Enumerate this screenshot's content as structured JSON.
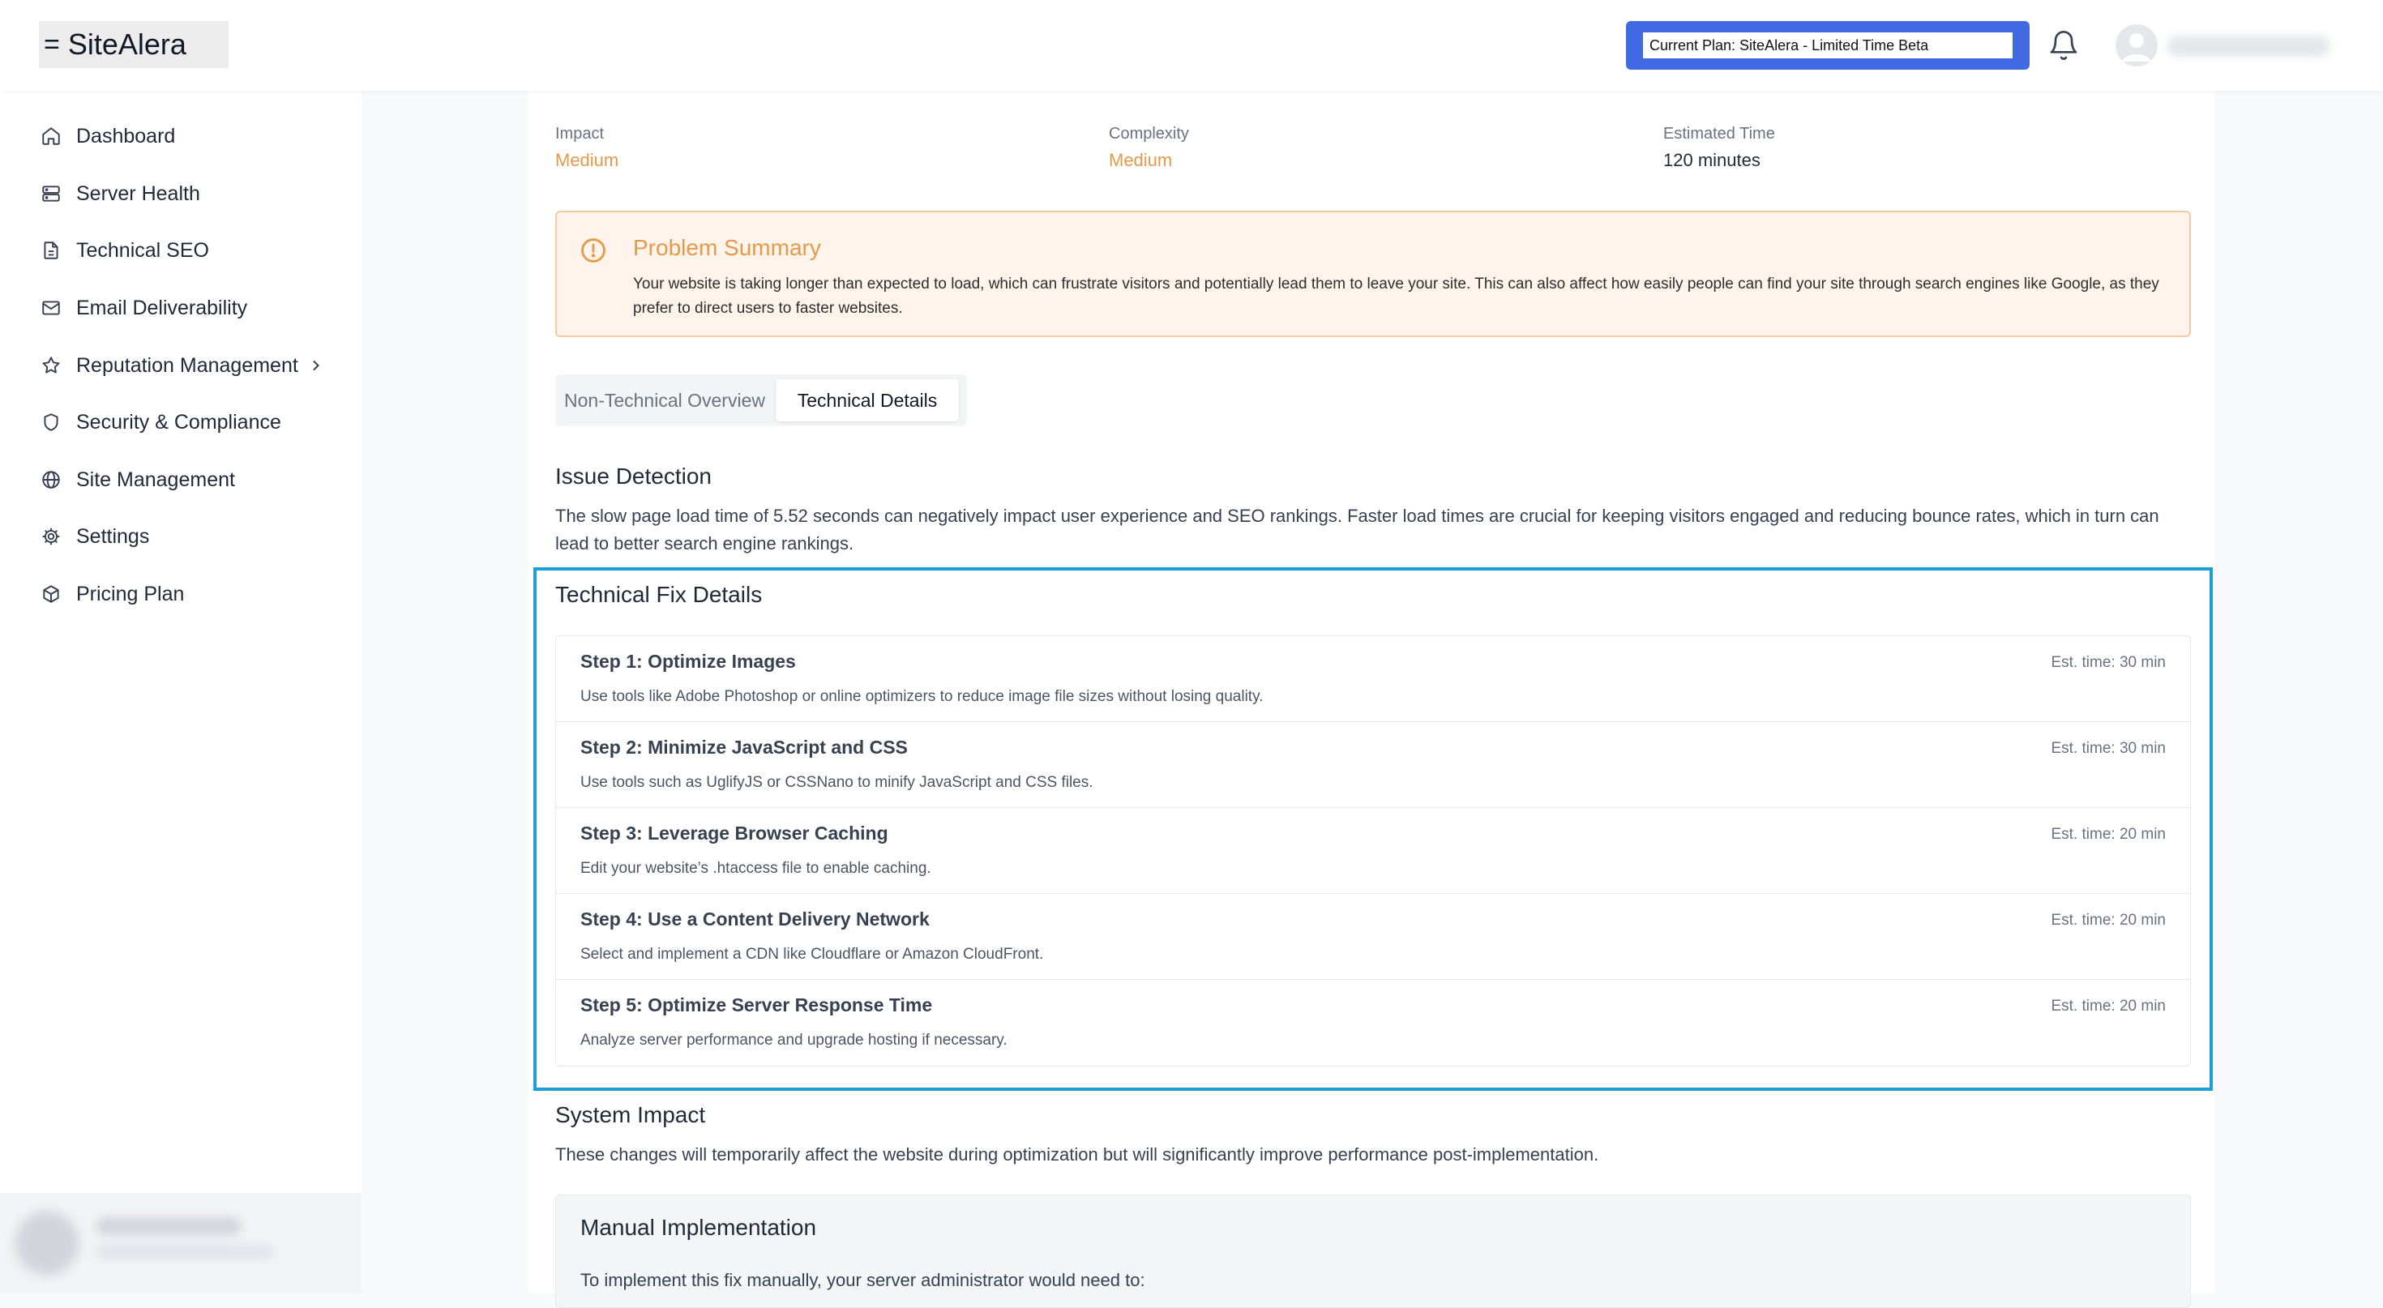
{
  "header": {
    "logo_text": "SiteAlera",
    "logo_icon": "menu-icon",
    "plan_label": "Current Plan: SiteAlera - Limited Time Beta",
    "plan_color": "#4169e1"
  },
  "sidebar": {
    "items": [
      {
        "label": "Dashboard",
        "icon": "home-icon"
      },
      {
        "label": "Server Health",
        "icon": "server-icon"
      },
      {
        "label": "Technical SEO",
        "icon": "document-icon"
      },
      {
        "label": "Email Deliverability",
        "icon": "mail-icon"
      },
      {
        "label": "Reputation Management",
        "icon": "star-icon"
      },
      {
        "label": "Security & Compliance",
        "icon": "shield-icon"
      },
      {
        "label": "Site Management",
        "icon": "globe-icon"
      },
      {
        "label": "Settings",
        "icon": "gear-icon"
      },
      {
        "label": "Pricing Plan",
        "icon": "package-icon"
      }
    ]
  },
  "meta": {
    "impact_label": "Impact",
    "impact_value": "Medium",
    "complexity_label": "Complexity",
    "complexity_value": "Medium",
    "time_label": "Estimated Time",
    "time_value": "120 minutes",
    "accent_color": "#e59a4a"
  },
  "problem": {
    "title": "Problem Summary",
    "text": "Your website is taking longer than expected to load, which can frustrate visitors and potentially lead them to leave your site. This can also affect how easily people can find your site through search engines like Google, as they prefer to direct users to faster websites."
  },
  "tabs": {
    "non_technical": "Non-Technical Overview",
    "technical": "Technical Details",
    "active": "Technical Details"
  },
  "issue": {
    "title": "Issue Detection",
    "text": "The slow page load time of 5.52 seconds can negatively impact user experience and SEO rankings. Faster load times are crucial for keeping visitors engaged and reducing bounce rates, which in turn can lead to better search engine rankings."
  },
  "fix": {
    "title": "Technical Fix Details",
    "steps": [
      {
        "title": "Step 1: Optimize Images",
        "desc": "Use tools like Adobe Photoshop or online optimizers to reduce image file sizes without losing quality.",
        "time": "Est. time: 30 min"
      },
      {
        "title": "Step 2: Minimize JavaScript and CSS",
        "desc": "Use tools such as UglifyJS or CSSNano to minify JavaScript and CSS files.",
        "time": "Est. time: 30 min"
      },
      {
        "title": "Step 3: Leverage Browser Caching",
        "desc": "Edit your website’s .htaccess file to enable caching.",
        "time": "Est. time: 20 min"
      },
      {
        "title": "Step 4: Use a Content Delivery Network",
        "desc": "Select and implement a CDN like Cloudflare or Amazon CloudFront.",
        "time": "Est. time: 20 min"
      },
      {
        "title": "Step 5: Optimize Server Response Time",
        "desc": "Analyze server performance and upgrade hosting if necessary.",
        "time": "Est. time: 20 min"
      }
    ]
  },
  "system": {
    "title": "System Impact",
    "text": "These changes will temporarily affect the website during optimization but will significantly improve performance post-implementation."
  },
  "manual": {
    "title": "Manual Implementation",
    "text": "To implement this fix manually, your server administrator would need to:"
  }
}
